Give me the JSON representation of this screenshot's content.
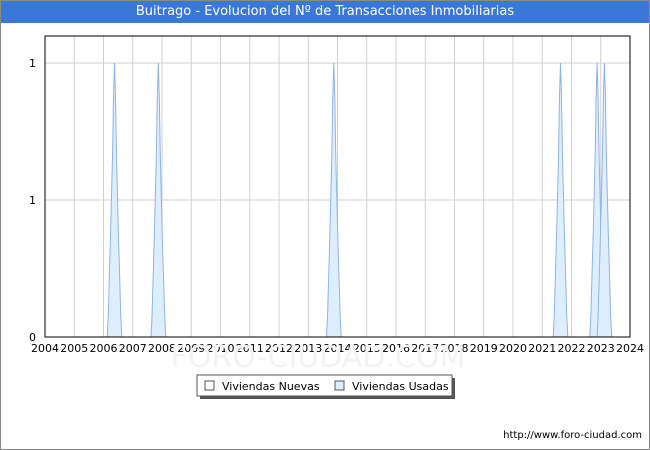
{
  "chart_data": {
    "type": "area",
    "title": "Buitrago - Evolucion del Nº de Transacciones Inmobiliarias",
    "x_ticks": [
      "2004",
      "2005",
      "2006",
      "2007",
      "2008",
      "2009",
      "2010",
      "2011",
      "2012",
      "2013",
      "2014",
      "2015",
      "2016",
      "2017",
      "2018",
      "2019",
      "2020",
      "2021",
      "2022",
      "2023",
      "2024"
    ],
    "y_ticks": [
      "0",
      "1",
      "1"
    ],
    "ylim": [
      0,
      1
    ],
    "xlim": [
      2004,
      2024
    ],
    "grid": true,
    "legend_position": "bottom",
    "series": [
      {
        "name": "Viviendas Nuevas",
        "color": "#ffffff",
        "points": []
      },
      {
        "name": "Viviendas Usadas",
        "color": "#ddeeff",
        "stroke": "#8fb4e6",
        "points": [
          {
            "date": "2006-Q2",
            "x": 2006.375,
            "y": 1
          },
          {
            "date": "2007-Q4",
            "x": 2007.875,
            "y": 1
          },
          {
            "date": "2013-Q4",
            "x": 2013.875,
            "y": 1
          },
          {
            "date": "2021-Q3",
            "x": 2021.625,
            "y": 1
          },
          {
            "date": "2022-Q4",
            "x": 2022.875,
            "y": 1
          },
          {
            "date": "2023-Q1",
            "x": 2023.125,
            "y": 1
          }
        ]
      }
    ]
  },
  "footer_text": "http://www.foro-ciudad.com",
  "watermark_text": "FORO-CIUDAD.COM"
}
